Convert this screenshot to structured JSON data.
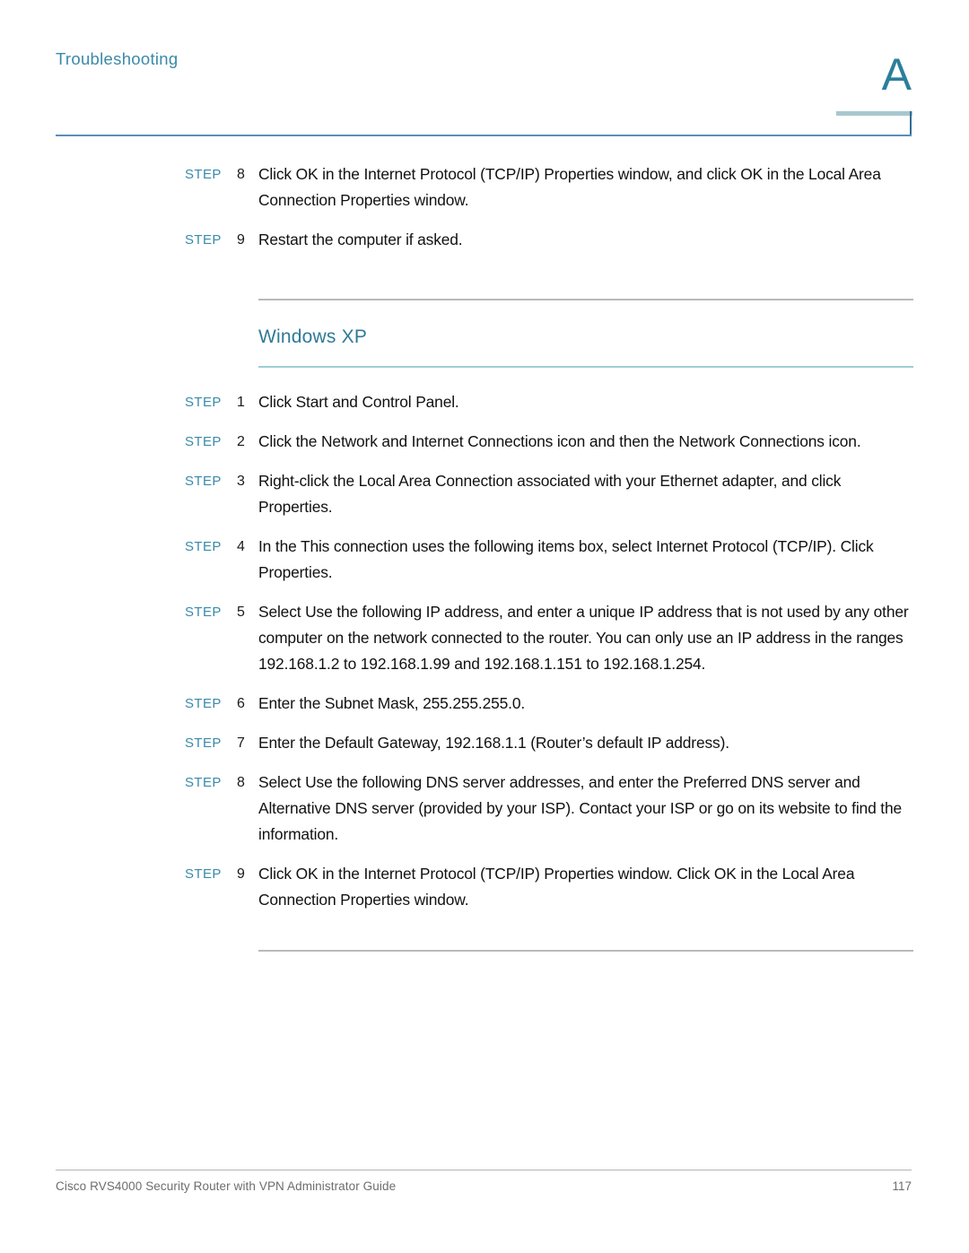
{
  "header": {
    "running_title": "Troubleshooting",
    "appendix_letter": "A"
  },
  "colors": {
    "accent_teal": "#3a8aa8",
    "heading_teal": "#2e7a96",
    "rule_blue": "#5b8fb9",
    "rule_gray": "#b9b9b9",
    "rule_light_teal": "#9fcdd6",
    "body_text": "#111111",
    "footer_text": "#6d6d6d"
  },
  "steps_top": [
    {
      "label": "STEP",
      "number": "8",
      "text": "Click OK in the Internet Protocol (TCP/IP) Properties window, and click OK in the Local Area Connection Properties window."
    },
    {
      "label": "STEP",
      "number": "9",
      "text": "Restart the computer if asked."
    }
  ],
  "section": {
    "heading": "Windows XP"
  },
  "steps_xp": [
    {
      "label": "STEP",
      "number": "1",
      "text": "Click Start and Control Panel."
    },
    {
      "label": "STEP",
      "number": "2",
      "text": "Click the Network and Internet Connections icon and then the Network Connections icon."
    },
    {
      "label": "STEP",
      "number": "3",
      "text": "Right-click the Local Area Connection associated with your Ethernet adapter, and click Properties."
    },
    {
      "label": "STEP",
      "number": "4",
      "text": "In the This connection uses the following items box, select Internet Protocol (TCP/IP). Click Properties."
    },
    {
      "label": "STEP",
      "number": "5",
      "text": "Select Use the following IP address, and enter a unique IP address that is not used by any other computer on the network connected to the router. You can only use an IP address in the ranges 192.168.1.2 to 192.168.1.99 and 192.168.1.151 to 192.168.1.254."
    },
    {
      "label": "STEP",
      "number": "6",
      "text": "Enter the Subnet Mask, 255.255.255.0."
    },
    {
      "label": "STEP",
      "number": "7",
      "text": "Enter the Default Gateway, 192.168.1.1 (Router’s default IP address)."
    },
    {
      "label": "STEP",
      "number": "8",
      "text": "Select Use the following DNS server addresses, and enter the Preferred DNS server and Alternative DNS server (provided by your ISP). Contact your ISP or go on its website to find the information."
    },
    {
      "label": "STEP",
      "number": "9",
      "text": "Click OK in the Internet Protocol (TCP/IP) Properties window. Click OK in the Local Area Connection Properties window."
    }
  ],
  "footer": {
    "guide_title": "Cisco RVS4000 Security Router with VPN Administrator Guide",
    "page_number": "117"
  }
}
